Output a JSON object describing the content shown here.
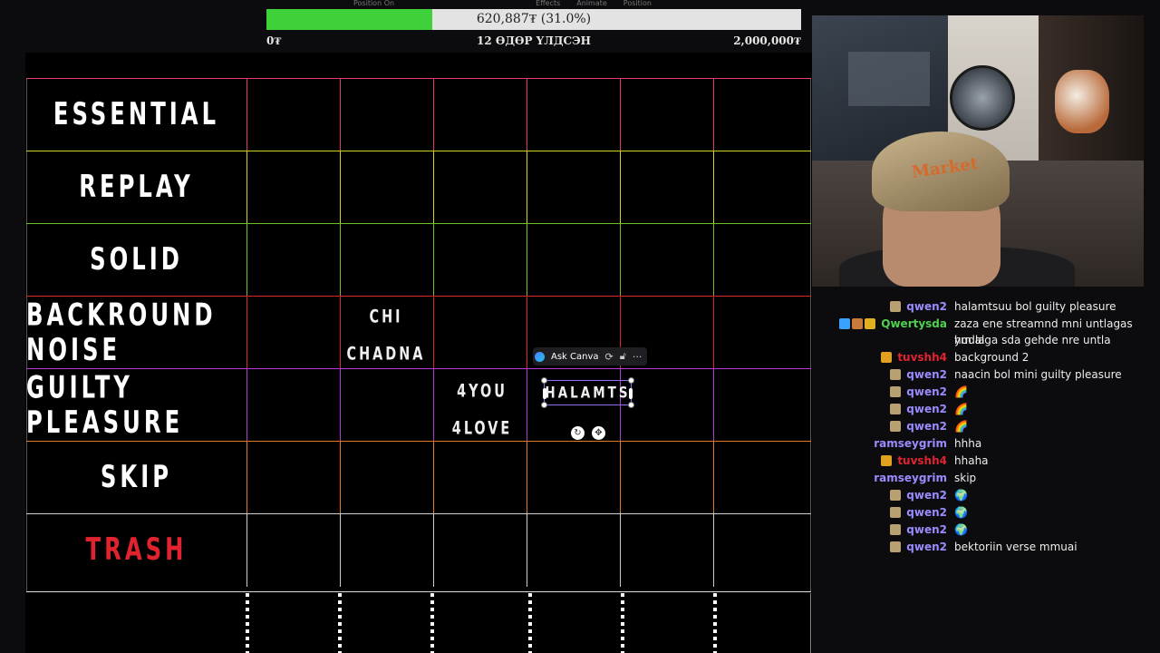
{
  "toolbar": {
    "items": [
      "Position On",
      "Effects",
      "Animate",
      "Position"
    ]
  },
  "progress": {
    "value_text": "620,887₮ (31.0%)",
    "fraction": 0.31,
    "fill_color": "#3fd13a",
    "min_label": "0₮",
    "center_label": "12 ӨДӨР ҮЛДСЭН",
    "max_label": "2,000,000₮"
  },
  "tiers": [
    {
      "label": "ESSENTIAL",
      "color": "#e13a6b",
      "label_color": "#ffffff"
    },
    {
      "label": "REPLAY",
      "color": "#d4d21f",
      "label_color": "#ffffff"
    },
    {
      "label": "SOLID",
      "color": "#6fc21e",
      "label_color": "#ffffff"
    },
    {
      "label": "BACKROUND NOISE",
      "color": "#d92828",
      "label_color": "#ffffff"
    },
    {
      "label": "GUILTY PLEASURE",
      "color": "#b63ad9",
      "label_color": "#ffffff"
    },
    {
      "label": "SKIP",
      "color": "#e47a22",
      "label_color": "#ffffff"
    },
    {
      "label": "TRASH",
      "color": "#cfcfcf",
      "label_color": "#e0232f"
    }
  ],
  "cells": {
    "chi_chadna": [
      "CHI",
      "CHADNA"
    ],
    "fouryou": [
      "4YOU",
      "4LOVE"
    ]
  },
  "selection": {
    "ask_label": "Ask Canva",
    "text": "HALAMTS",
    "more": "···"
  },
  "webcam": {
    "cap_text": "Market"
  },
  "chat": [
    {
      "user": "qwen2",
      "color": "#9a8cff",
      "badges": [
        "#b8a070"
      ],
      "msg": "halamtsuu bol guilty pleasure"
    },
    {
      "user": "Qwertysda",
      "color": "#4fd14f",
      "badges": [
        "#3aa0ff",
        "#c77a3a",
        "#e0b020"
      ],
      "msg": "zaza ene streamnd mni untlagas hudla",
      "msg2": "ym alga sda gehde nre untla"
    },
    {
      "user": "tuvshh4",
      "color": "#e0232f",
      "badges": [
        "#e0a020"
      ],
      "msg": "background 2"
    },
    {
      "user": "qwen2",
      "color": "#9a8cff",
      "badges": [
        "#b8a070"
      ],
      "msg": "naacin bol mini guilty pleasure"
    },
    {
      "user": "qwen2",
      "color": "#9a8cff",
      "badges": [
        "#b8a070"
      ],
      "msg": "🌈",
      "emote": true
    },
    {
      "user": "qwen2",
      "color": "#9a8cff",
      "badges": [
        "#b8a070"
      ],
      "msg": "🌈",
      "emote": true
    },
    {
      "user": "qwen2",
      "color": "#9a8cff",
      "badges": [
        "#b8a070"
      ],
      "msg": "🌈",
      "emote": true
    },
    {
      "user": "ramseygrim",
      "color": "#9a8cff",
      "badges": [],
      "msg": "hhha"
    },
    {
      "user": "tuvshh4",
      "color": "#e0232f",
      "badges": [
        "#e0a020"
      ],
      "msg": "hhaha"
    },
    {
      "user": "ramseygrim",
      "color": "#9a8cff",
      "badges": [],
      "msg": "skip"
    },
    {
      "user": "qwen2",
      "color": "#9a8cff",
      "badges": [
        "#b8a070"
      ],
      "msg": "🌍",
      "emote": true
    },
    {
      "user": "qwen2",
      "color": "#9a8cff",
      "badges": [
        "#b8a070"
      ],
      "msg": "🌍",
      "emote": true
    },
    {
      "user": "qwen2",
      "color": "#9a8cff",
      "badges": [
        "#b8a070"
      ],
      "msg": "🌍",
      "emote": true
    },
    {
      "user": "qwen2",
      "color": "#9a8cff",
      "badges": [
        "#b8a070"
      ],
      "msg": "bektoriin verse mmuai"
    }
  ]
}
